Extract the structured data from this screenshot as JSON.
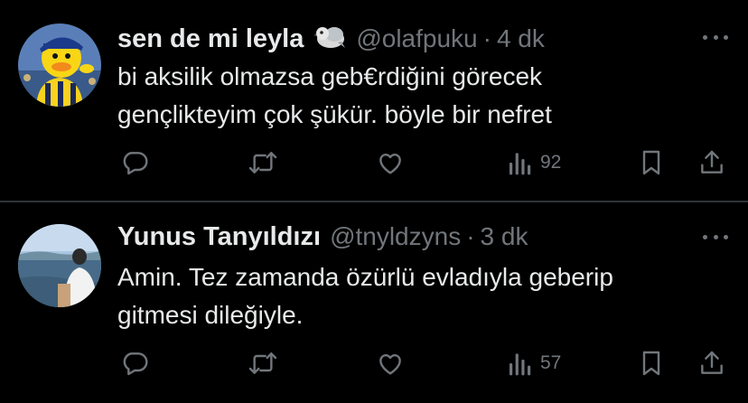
{
  "tweets": [
    {
      "display_name": "sen de mi leyla",
      "handle": "@olafpuku",
      "separator": "·",
      "time": "4 dk",
      "text_lines": [
        "bi aksilik olmazsa geb€rdiğini görecek",
        "gençlikteyim çok şükür. böyle bir nefret"
      ],
      "views": "92"
    },
    {
      "display_name": "Yunus Tanyıldızı",
      "handle": "@tnyldzyns",
      "separator": "·",
      "time": "3 dk",
      "text_lines": [
        "Amin. Tez zamanda özürlü evladıyla geberip",
        "gitmesi dileğiyle."
      ],
      "views": "57"
    }
  ],
  "colors": {
    "background": "#000000",
    "text_primary": "#e7e9ea",
    "text_secondary": "#71767b",
    "divider": "#2f3336"
  },
  "icons": [
    "reply-icon",
    "retweet-icon",
    "like-icon",
    "views-icon",
    "bookmark-icon",
    "share-icon",
    "more-icon",
    "bird-emoji-icon"
  ]
}
